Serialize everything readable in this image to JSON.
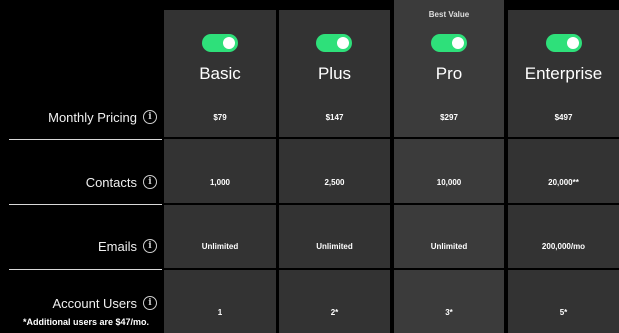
{
  "rows": [
    {
      "label": "Monthly Pricing",
      "icon": "info-icon"
    },
    {
      "label": "Contacts",
      "icon": "info-icon"
    },
    {
      "label": "Emails",
      "icon": "info-icon"
    },
    {
      "label": "Account Users",
      "icon": "info-icon",
      "note": "*Additional users are $47/mo."
    }
  ],
  "badge": "Best Value",
  "plans": [
    {
      "name": "Basic",
      "toggle_on": true,
      "values": [
        "$79",
        "1,000",
        "Unlimited",
        "1"
      ]
    },
    {
      "name": "Plus",
      "toggle_on": true,
      "values": [
        "$147",
        "2,500",
        "Unlimited",
        "2*"
      ]
    },
    {
      "name": "Pro",
      "toggle_on": true,
      "values": [
        "$297",
        "10,000",
        "Unlimited",
        "3*"
      ]
    },
    {
      "name": "Enterprise",
      "toggle_on": true,
      "values": [
        "$497",
        "20,000**",
        "200,000/mo",
        "5*"
      ]
    }
  ],
  "colors": {
    "toggle": "#2ee07a",
    "column": "#333333",
    "background": "#000000"
  }
}
